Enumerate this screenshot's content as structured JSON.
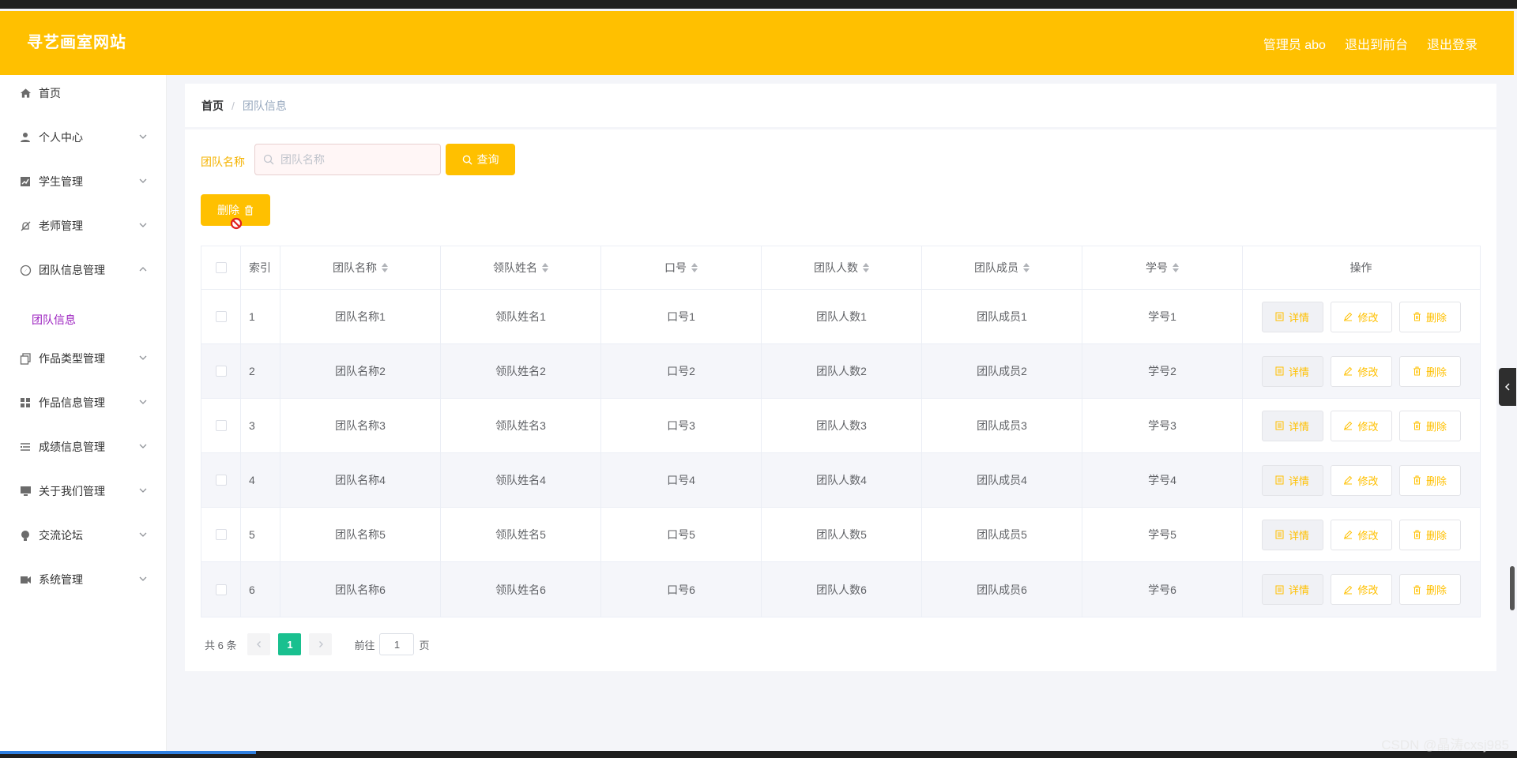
{
  "header": {
    "title": "寻艺画室网站",
    "admin": "管理员 abo",
    "to_front": "退出到前台",
    "logout": "退出登录"
  },
  "sidebar": {
    "items": [
      {
        "label": "首页",
        "icon": "home-icon"
      },
      {
        "label": "个人中心",
        "icon": "user-icon"
      },
      {
        "label": "学生管理",
        "icon": "chart-icon"
      },
      {
        "label": "老师管理",
        "icon": "bell-off-icon"
      },
      {
        "label": "团队信息管理",
        "icon": "compass-icon"
      },
      {
        "label": "作品类型管理",
        "icon": "copy-icon"
      },
      {
        "label": "作品信息管理",
        "icon": "grid-icon"
      },
      {
        "label": "成绩信息管理",
        "icon": "list-icon"
      },
      {
        "label": "关于我们管理",
        "icon": "monitor-icon"
      },
      {
        "label": "交流论坛",
        "icon": "bulb-icon"
      },
      {
        "label": "系统管理",
        "icon": "camera-icon"
      }
    ],
    "submenu": {
      "label": "团队信息"
    }
  },
  "breadcrumb": {
    "home": "首页",
    "sep": "/",
    "current": "团队信息"
  },
  "search": {
    "label": "团队名称",
    "placeholder": "团队名称",
    "query_button": "查询"
  },
  "toolbar": {
    "delete_button": "删除"
  },
  "table": {
    "headers": [
      "索引",
      "团队名称",
      "领队姓名",
      "口号",
      "团队人数",
      "团队成员",
      "学号",
      "操作"
    ],
    "rows": [
      {
        "index": "1",
        "team": "团队名称1",
        "leader": "领队姓名1",
        "slogan": "口号1",
        "count": "团队人数1",
        "members": "团队成员1",
        "sid": "学号1"
      },
      {
        "index": "2",
        "team": "团队名称2",
        "leader": "领队姓名2",
        "slogan": "口号2",
        "count": "团队人数2",
        "members": "团队成员2",
        "sid": "学号2"
      },
      {
        "index": "3",
        "team": "团队名称3",
        "leader": "领队姓名3",
        "slogan": "口号3",
        "count": "团队人数3",
        "members": "团队成员3",
        "sid": "学号3"
      },
      {
        "index": "4",
        "team": "团队名称4",
        "leader": "领队姓名4",
        "slogan": "口号4",
        "count": "团队人数4",
        "members": "团队成员4",
        "sid": "学号4"
      },
      {
        "index": "5",
        "team": "团队名称5",
        "leader": "领队姓名5",
        "slogan": "口号5",
        "count": "团队人数5",
        "members": "团队成员5",
        "sid": "学号5"
      },
      {
        "index": "6",
        "team": "团队名称6",
        "leader": "领队姓名6",
        "slogan": "口号6",
        "count": "团队人数6",
        "members": "团队成员6",
        "sid": "学号6"
      }
    ],
    "actions": {
      "detail": "详情",
      "edit": "修改",
      "delete": "删除"
    }
  },
  "pagination": {
    "total": "共 6 条",
    "current_page": "1",
    "goto_prefix": "前往",
    "goto_value": "1",
    "goto_suffix": "页"
  },
  "watermark": "CSDN @晶涛cxsj985",
  "colors": {
    "accent": "#ffc000",
    "active_page": "#19c08f",
    "submenu_active": "#9b1fbf"
  }
}
